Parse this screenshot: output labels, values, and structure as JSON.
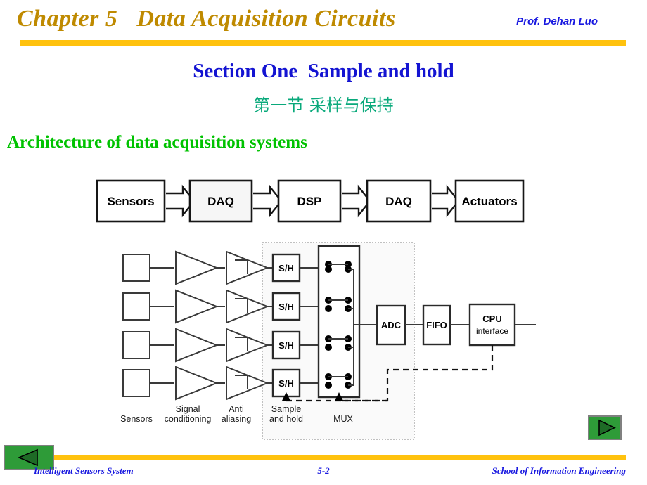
{
  "header": {
    "chapter_title": "Chapter 5   Data Acquisition Circuits",
    "professor": "Prof. Dehan Luo",
    "bar_color": "#FFC20E",
    "title_color": "#BF8A00",
    "professor_color": "#1818E0"
  },
  "titles": {
    "section_en": "Section One  Sample and hold",
    "section_cn": "第一节 采样与保持",
    "architecture": "Architecture of data acquisition systems",
    "section_en_color": "#1414D2",
    "section_cn_color": "#09A97B",
    "architecture_color": "#00C200"
  },
  "top_chain": {
    "blocks": [
      {
        "label": "Sensors"
      },
      {
        "label": "DAQ"
      },
      {
        "label": "DSP"
      },
      {
        "label": "DAQ"
      },
      {
        "label": "Actuators"
      }
    ]
  },
  "detail_diagram": {
    "channel_blocks": [
      {
        "sample_hold": "S/H"
      },
      {
        "sample_hold": "S/H"
      },
      {
        "sample_hold": "S/H"
      },
      {
        "sample_hold": "S/H"
      }
    ],
    "adc": "ADC",
    "fifo": "FIFO",
    "cpu_line1": "CPU",
    "cpu_line2": "interface",
    "stage_labels": {
      "sensors": "Sensors",
      "signal_conditioning_line1": "Signal",
      "signal_conditioning_line2": "conditioning",
      "anti_aliasing_line1": "Anti",
      "anti_aliasing_line2": "aliasing",
      "sample_hold_line1": "Sample",
      "sample_hold_line2": "and hold",
      "mux": "MUX"
    }
  },
  "footer": {
    "left": "Intelligent Sensors System",
    "center": "5-2",
    "right": "School of Information Engineering",
    "bar_color": "#FFC20E",
    "text_color": "#1818E0",
    "nav_prev_icon": "triangle-left-icon",
    "nav_next_icon": "triangle-right-icon",
    "nav_button_color": "#2E9B38"
  }
}
